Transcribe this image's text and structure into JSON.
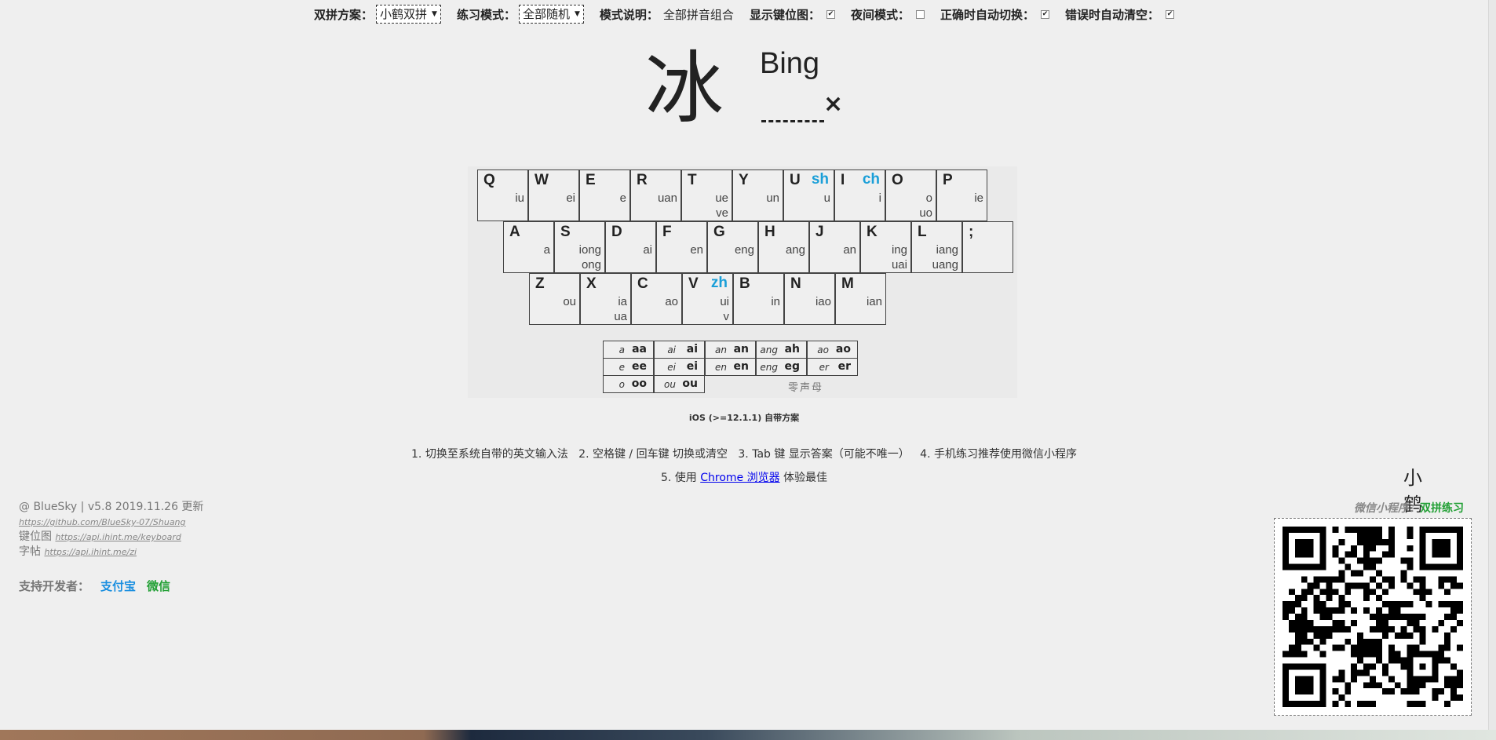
{
  "settings": {
    "scheme_label": "双拼方案：",
    "scheme_value": "小鹤双拼",
    "mode_label": "练习模式：",
    "mode_value": "全部随机",
    "desc_label": "模式说明：",
    "desc_value": "全部拼音组合",
    "show_keymap_label": "显示键位图：",
    "show_keymap_checked": true,
    "night_label": "夜间模式：",
    "night_checked": false,
    "autoswitch_label": "正确时自动切换：",
    "autoswitch_checked": true,
    "autoclear_label": "错误时自动清空：",
    "autoclear_checked": true
  },
  "practice": {
    "hanzi": "冰",
    "pinyin": "Bing",
    "wrong_mark": "×"
  },
  "keyboard": {
    "rows": [
      [
        {
          "key": "Q",
          "finals": [
            "iu"
          ]
        },
        {
          "key": "W",
          "finals": [
            "ei"
          ]
        },
        {
          "key": "E",
          "finals": [
            "e"
          ]
        },
        {
          "key": "R",
          "finals": [
            "uan"
          ]
        },
        {
          "key": "T",
          "finals": [
            "ue",
            "ve"
          ]
        },
        {
          "key": "Y",
          "finals": [
            "un"
          ]
        },
        {
          "key": "U",
          "initial": "sh",
          "finals": [
            "u"
          ]
        },
        {
          "key": "I",
          "initial": "ch",
          "finals": [
            "i"
          ]
        },
        {
          "key": "O",
          "finals": [
            "o",
            "uo"
          ]
        },
        {
          "key": "P",
          "finals": [
            "ie"
          ]
        }
      ],
      [
        {
          "key": "A",
          "finals": [
            "a"
          ]
        },
        {
          "key": "S",
          "finals": [
            "iong",
            "ong"
          ]
        },
        {
          "key": "D",
          "finals": [
            "ai"
          ]
        },
        {
          "key": "F",
          "finals": [
            "en"
          ]
        },
        {
          "key": "G",
          "finals": [
            "eng"
          ]
        },
        {
          "key": "H",
          "finals": [
            "ang"
          ]
        },
        {
          "key": "J",
          "finals": [
            "an"
          ]
        },
        {
          "key": "K",
          "finals": [
            "ing",
            "uai"
          ]
        },
        {
          "key": "L",
          "finals": [
            "iang",
            "uang"
          ]
        },
        {
          "key": ";",
          "finals": []
        }
      ],
      [
        {
          "key": "Z",
          "finals": [
            "ou"
          ]
        },
        {
          "key": "X",
          "finals": [
            "ia",
            "ua"
          ]
        },
        {
          "key": "C",
          "finals": [
            "ao"
          ]
        },
        {
          "key": "V",
          "initial": "zh",
          "finals": [
            "ui",
            "v"
          ]
        },
        {
          "key": "B",
          "finals": [
            "in"
          ]
        },
        {
          "key": "N",
          "finals": [
            "iao"
          ]
        },
        {
          "key": "M",
          "finals": [
            "ian"
          ]
        }
      ]
    ],
    "scheme_name_line1": "小鹤",
    "scheme_name_line2": "双拼",
    "zero_consonant": [
      [
        {
          "py": "a",
          "code": "aa"
        },
        {
          "py": "ai",
          "code": "ai"
        },
        {
          "py": "an",
          "code": "an"
        },
        {
          "py": "ang",
          "code": "ah"
        },
        {
          "py": "ao",
          "code": "ao"
        }
      ],
      [
        {
          "py": "e",
          "code": "ee"
        },
        {
          "py": "ei",
          "code": "ei"
        },
        {
          "py": "en",
          "code": "en"
        },
        {
          "py": "eng",
          "code": "eg"
        },
        {
          "py": "er",
          "code": "er"
        }
      ],
      [
        {
          "py": "o",
          "code": "oo"
        },
        {
          "py": "ou",
          "code": "ou"
        }
      ]
    ],
    "zero_label": "零声母",
    "caption": "iOS (>=12.1.1) 自带方案"
  },
  "tips": {
    "line1": "1. 切换至系统自带的英文输入法   2. 空格键 / 回车键 切换或清空   3. Tab 键 显示答案（可能不唯一）   4. 手机练习推荐使用微信小程序",
    "line2_pre": "5. 使用 ",
    "line2_link": "Chrome 浏览器",
    "line2_post": " 体验最佳"
  },
  "footer": {
    "version": "@ BlueSky | v5.8 2019.11.26 更新",
    "github": "https://github.com/BlueSky-07/Shuang",
    "keymap_label": "键位图 ",
    "keymap_url": "https://api.ihint.me/keyboard",
    "zi_label": "字帖 ",
    "zi_url": "https://api.ihint.me/zi",
    "support_label": "支持开发者：",
    "alipay": "支付宝",
    "wechat": "微信",
    "mp_prefix": "微信小程序：",
    "mp_name": "双拼练习"
  }
}
